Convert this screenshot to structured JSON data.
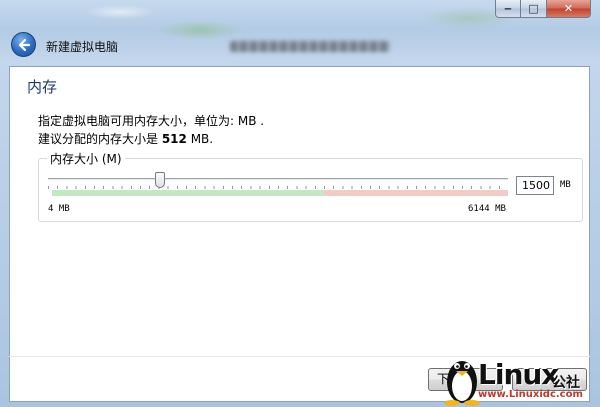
{
  "window": {
    "title": "新建虚拟电脑",
    "buttons": {
      "minimize": "‒",
      "maximize": "□",
      "close": "✕"
    }
  },
  "page": {
    "heading": "内存",
    "description_line1": "指定虚拟电脑可用内存大小，单位为: MB .",
    "description_line2_prefix": "建议分配的内存大小是 ",
    "recommended_value": "512",
    "description_line2_suffix": " MB."
  },
  "memory": {
    "group_label": "内存大小 (M)",
    "current_value": "1500",
    "current_mb": 1500,
    "min_mb": 4,
    "max_mb": 6144,
    "min_label": "4 MB",
    "max_label": "6144 MB",
    "unit": "MB"
  },
  "footer": {
    "next_label": "下"
  },
  "watermark": {
    "brand": "Linux",
    "suffix": "公社",
    "url": "www.Linuxidc.com"
  },
  "icons": {
    "back": "back-arrow-icon"
  },
  "colors": {
    "heading": "#1d3a6e",
    "safe_band": "#c4e8c2",
    "warn_band": "#f3cbc6"
  }
}
